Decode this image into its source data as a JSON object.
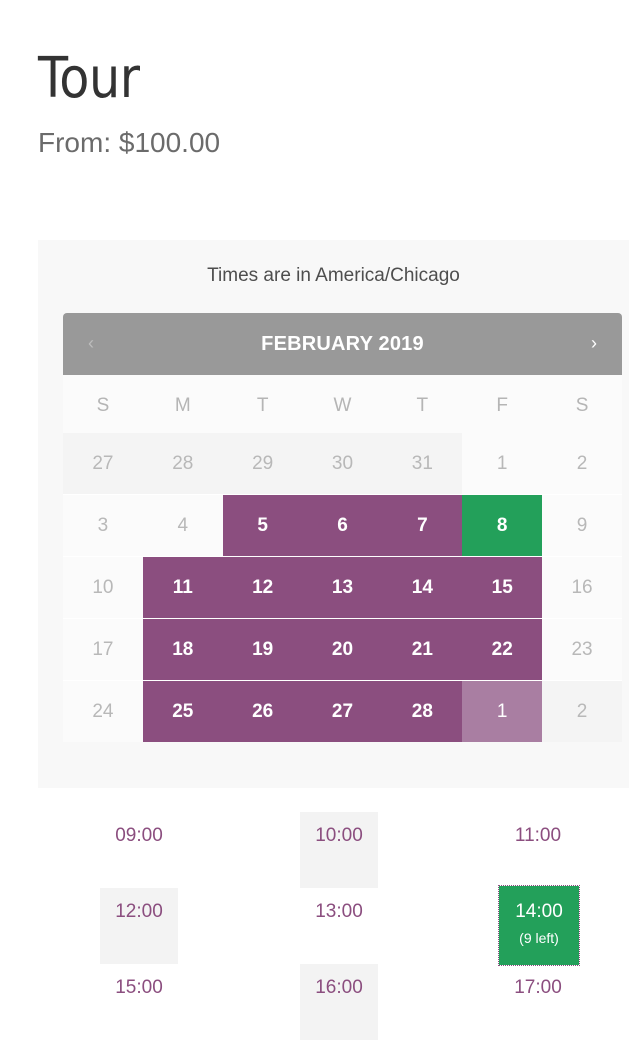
{
  "product": {
    "title": "Tour",
    "price_label": "From: $100.00"
  },
  "booking": {
    "timezone_note": "Times are in America/Chicago",
    "calendar": {
      "month_label": "FEBRUARY 2019",
      "prev_icon": "chevron-left-icon",
      "next_icon": "chevron-right-icon",
      "weekdays": [
        "S",
        "M",
        "T",
        "W",
        "T",
        "F",
        "S"
      ],
      "weeks": [
        [
          {
            "day": "27",
            "state": "other"
          },
          {
            "day": "28",
            "state": "other"
          },
          {
            "day": "29",
            "state": "other"
          },
          {
            "day": "30",
            "state": "other"
          },
          {
            "day": "31",
            "state": "other"
          },
          {
            "day": "1",
            "state": "unavailable"
          },
          {
            "day": "2",
            "state": "unavailable"
          }
        ],
        [
          {
            "day": "3",
            "state": "unavailable"
          },
          {
            "day": "4",
            "state": "unavailable"
          },
          {
            "day": "5",
            "state": "available"
          },
          {
            "day": "6",
            "state": "available"
          },
          {
            "day": "7",
            "state": "available"
          },
          {
            "day": "8",
            "state": "selected"
          },
          {
            "day": "9",
            "state": "unavailable"
          }
        ],
        [
          {
            "day": "10",
            "state": "unavailable"
          },
          {
            "day": "11",
            "state": "available"
          },
          {
            "day": "12",
            "state": "available"
          },
          {
            "day": "13",
            "state": "available"
          },
          {
            "day": "14",
            "state": "available"
          },
          {
            "day": "15",
            "state": "available"
          },
          {
            "day": "16",
            "state": "unavailable"
          }
        ],
        [
          {
            "day": "17",
            "state": "unavailable"
          },
          {
            "day": "18",
            "state": "available"
          },
          {
            "day": "19",
            "state": "available"
          },
          {
            "day": "20",
            "state": "available"
          },
          {
            "day": "21",
            "state": "available"
          },
          {
            "day": "22",
            "state": "available"
          },
          {
            "day": "23",
            "state": "unavailable"
          }
        ],
        [
          {
            "day": "24",
            "state": "unavailable"
          },
          {
            "day": "25",
            "state": "available"
          },
          {
            "day": "26",
            "state": "available"
          },
          {
            "day": "27",
            "state": "available"
          },
          {
            "day": "28",
            "state": "available"
          },
          {
            "day": "1",
            "state": "available-other"
          },
          {
            "day": "2",
            "state": "other"
          }
        ]
      ]
    },
    "time_slots": [
      {
        "time": "09:00",
        "shaded": false
      },
      {
        "time": "10:00",
        "shaded": true
      },
      {
        "time": "11:00",
        "shaded": false
      },
      {
        "time": "12:00",
        "shaded": true
      },
      {
        "time": "13:00",
        "shaded": false
      },
      {
        "time": "14:00",
        "selected": true,
        "remaining": "(9 left)"
      },
      {
        "time": "15:00",
        "shaded": false
      },
      {
        "time": "16:00",
        "shaded": true
      },
      {
        "time": "17:00",
        "shaded": false
      }
    ]
  },
  "colors": {
    "available": "#8b4e7f",
    "selected": "#23a05a",
    "header": "#999999",
    "available_other_month": "#a97ea2"
  }
}
